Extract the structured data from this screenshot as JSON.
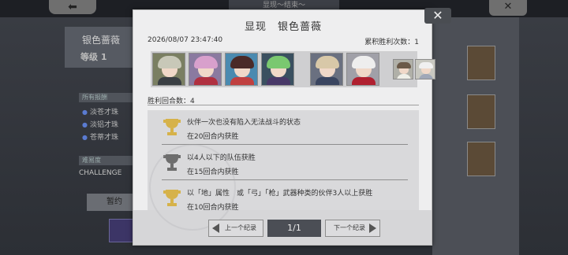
{
  "background": {
    "back_label": "⬅",
    "tab_label": "显现～结束～",
    "close_label": "✕",
    "name": "银色蔷薇",
    "level": "等级  1",
    "section1": "所有报酬",
    "items": [
      "淡苍才珠",
      "淡铝才珠",
      "苍蒂才珠"
    ],
    "section2": "难易度",
    "challenge": "CHALLENGE",
    "button": "暂约"
  },
  "modal": {
    "title": "显现　银色蔷薇",
    "close_label": "✕",
    "timestamp": "2026/08/07 23:47:40",
    "wins_label": "累积胜利次数：",
    "wins_value": "1",
    "rounds_label": "胜利回合数：",
    "rounds_value": "4",
    "conditions": [
      {
        "text": "伙伴一次也没有陷入无法战斗的状态",
        "sub": "在20回合内获胜",
        "cup_color": "#d6b24a"
      },
      {
        "text": "以4人以下的队伍获胜",
        "sub": "在15回合内获胜",
        "cup_color": "#6e6e6e"
      },
      {
        "text": "以「地」属性　或「弓」「枪」武器种类的伙伴3人以上获胜",
        "sub": "在10回合内获胜",
        "cup_color": "#d6b24a"
      }
    ],
    "prev_label": "上一个纪录",
    "next_label": "下一个纪录",
    "page": "1/1"
  },
  "party": [
    {
      "name": "silver-haired-knight",
      "hair": "#c8c8b8",
      "bg": "#7a7f62",
      "body": "#3a3f44"
    },
    {
      "name": "pink-haired-girl",
      "hair": "#d8a0cc",
      "bg": "#8a7aa0",
      "body": "#b03040"
    },
    {
      "name": "dark-haired-girl",
      "hair": "#4a2a28",
      "bg": "#4a8ab0",
      "body": "#c04040"
    },
    {
      "name": "green-haired-mage",
      "hair": "#7ac870",
      "bg": "#3a5060",
      "body": "#483868"
    },
    {
      "name": "blonde-knight",
      "hair": "#d8c8a8",
      "bg": "#6a7080",
      "body": "#3a4560"
    },
    {
      "name": "white-haired-girl",
      "hair": "#eeeeee",
      "bg": "#a0a0a8",
      "body": "#b02030"
    },
    {
      "name": "bird-companion",
      "hair": "#6b5a48",
      "bg": "#b0b0a8",
      "body": "#efefe8"
    },
    {
      "name": "white-creature",
      "hair": "#f0f0f0",
      "bg": "#c8c8c0",
      "body": "#a0a8b8"
    }
  ]
}
